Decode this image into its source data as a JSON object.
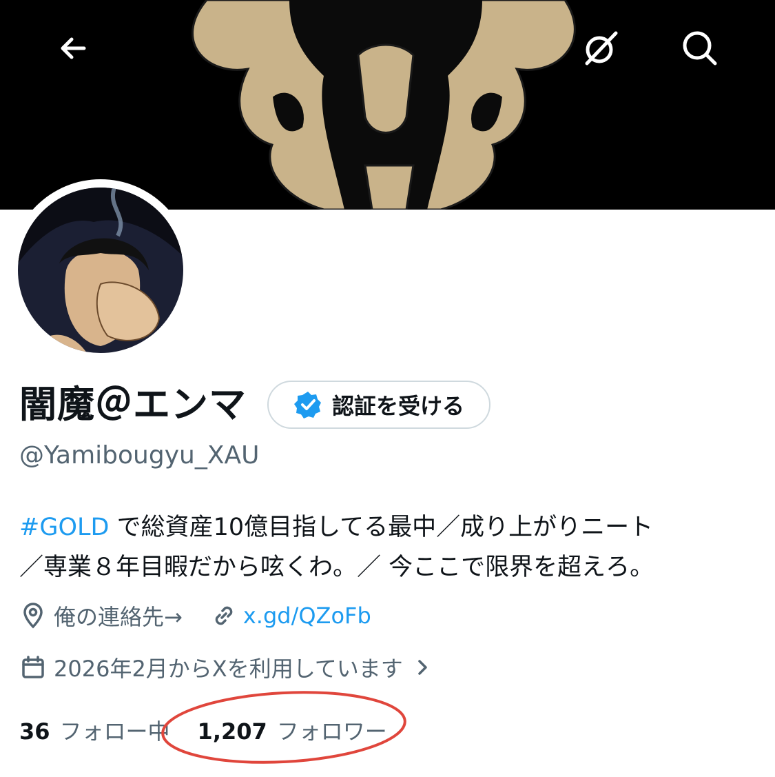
{
  "header": {
    "back_icon": "arrow-left-icon",
    "grok_icon": "grok-icon",
    "search_icon": "search-icon",
    "banner_colors": {
      "background": "#000000",
      "emblem": "#c9b38a"
    }
  },
  "profile": {
    "display_name": "闇魔＠エンマ",
    "verify_button_label": "認証を受ける",
    "handle": "@Yamibougyu_XAU",
    "bio_hashtag": "#GOLD",
    "bio_line1_rest": " で総資産10億目指してる最中／成り上がりニート",
    "bio_line2": "／専業８年目暇だから呟くわ。／ 今ここで限界を超えろ。",
    "location": "俺の連絡先→",
    "website": "x.gd/QZoFb",
    "joined": "2026年2月からXを利用しています",
    "following_count": "36",
    "following_label": "フォロー中",
    "followers_count": "1,207",
    "followers_label": "フォロワー"
  },
  "colors": {
    "accent": "#1d9bf0",
    "secondary_text": "#536471",
    "annotation": "#e0463c"
  }
}
